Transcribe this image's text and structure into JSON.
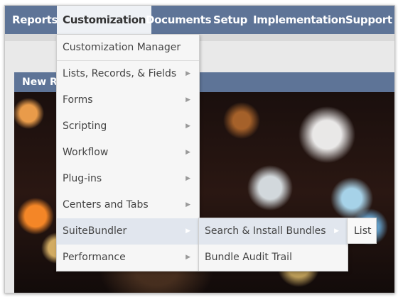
{
  "navbar": {
    "items": [
      {
        "label": "Reports",
        "active": false
      },
      {
        "label": "Customization",
        "active": true
      },
      {
        "label": "Documents",
        "active": false
      },
      {
        "label": "Setup",
        "active": false
      },
      {
        "label": "Implementation",
        "active": false
      },
      {
        "label": "Support",
        "active": false
      }
    ]
  },
  "portlet": {
    "title": "New Re"
  },
  "customization_menu": {
    "items": [
      {
        "label": "Customization Manager",
        "has_submenu": false
      },
      {
        "label": "Lists, Records, & Fields",
        "has_submenu": true
      },
      {
        "label": "Forms",
        "has_submenu": true
      },
      {
        "label": "Scripting",
        "has_submenu": true
      },
      {
        "label": "Workflow",
        "has_submenu": true
      },
      {
        "label": "Plug-ins",
        "has_submenu": true
      },
      {
        "label": "Centers and Tabs",
        "has_submenu": true
      },
      {
        "label": "SuiteBundler",
        "has_submenu": true,
        "highlighted": true
      },
      {
        "label": "Performance",
        "has_submenu": true
      }
    ]
  },
  "suitebundler_menu": {
    "items": [
      {
        "label": "Search & Install Bundles",
        "has_submenu": true,
        "highlighted": true
      },
      {
        "label": "Bundle Audit Trail",
        "has_submenu": false
      }
    ]
  },
  "search_install_submenu": {
    "items": [
      {
        "label": "List"
      }
    ]
  },
  "icons": {
    "submenu_arrow": "right-triangle-icon"
  },
  "colors": {
    "navbar": "#5e7497",
    "menu_highlight": "#e1e6ee",
    "menu_background": "#f6f6f6"
  }
}
